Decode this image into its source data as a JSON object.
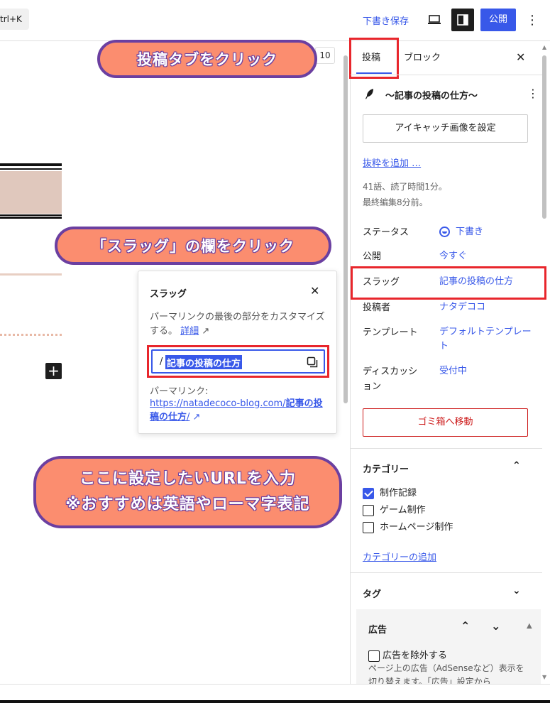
{
  "topbar": {
    "shortcut": "trl+K",
    "save_draft": "下書き保存",
    "publish": "公開"
  },
  "editor": {
    "revision_count": "10",
    "add_block": "+"
  },
  "callouts": {
    "c1": "投稿タブをクリック",
    "c2": "「スラッグ」の欄をクリック",
    "c3_line1": "ここに設定したいURLを入力",
    "c3_line2": "※おすすめは英語やローマ字表記"
  },
  "popover": {
    "title": "スラッグ",
    "desc": "パーマリンクの最後の部分をカスタマイズする。",
    "detail_link": "詳細",
    "slug_prefix": "/",
    "slug_value": "記事の投稿の仕方",
    "permalink_label": "パーマリンク:",
    "permalink_base": "https://natadecoco-blog.com/",
    "permalink_slug": "記事の投稿の仕方",
    "permalink_end": "/"
  },
  "sidebar": {
    "tab_post": "投稿",
    "tab_block": "ブロック",
    "post_name": "～記事の投稿の仕方～",
    "featured_image_button": "アイキャッチ画像を設定",
    "add_excerpt": "抜粋を追加 …",
    "stats_line1": "41語、読了時間1分。",
    "stats_line2": "最終編集8分前。",
    "meta": [
      {
        "key": "ステータス",
        "value": "下書き"
      },
      {
        "key": "公開",
        "value": "今すぐ"
      },
      {
        "key": "スラッグ",
        "value": "記事の投稿の仕方"
      },
      {
        "key": "投稿者",
        "value": "ナタデココ"
      },
      {
        "key": "テンプレート",
        "value": "デフォルトテンプレート"
      },
      {
        "key": "ディスカッション",
        "value": "受付中"
      }
    ],
    "trash_button": "ゴミ箱へ移動",
    "categories_title": "カテゴリー",
    "categories": [
      {
        "label": "制作記録",
        "checked": true
      },
      {
        "label": "ゲーム制作",
        "checked": false
      },
      {
        "label": "ホームページ制作",
        "checked": false
      }
    ],
    "add_category": "カテゴリーの追加",
    "tags_title": "タグ",
    "ad_title": "広告",
    "ad_checkbox": "広告を除外する",
    "ad_desc": "ページ上の広告（AdSenseなど）表示を切り替えます。「広告」設定から"
  },
  "colors": {
    "accent": "#3858e9",
    "highlight": "#e8262c",
    "callout_fill": "#fb8d6f",
    "callout_border": "#6b3fa0"
  }
}
